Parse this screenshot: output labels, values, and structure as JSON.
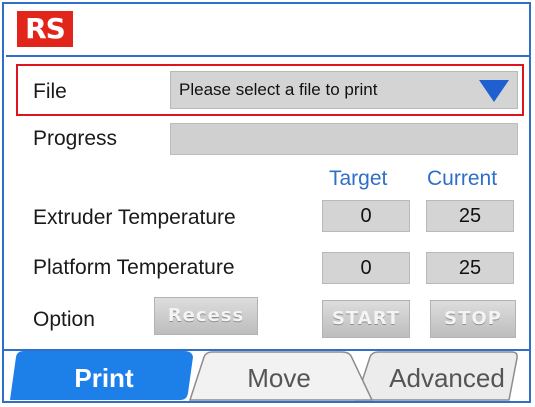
{
  "header": {
    "logo_text": "RS"
  },
  "file": {
    "label": "File",
    "selected": "Please select a file to print"
  },
  "progress": {
    "label": "Progress",
    "value": 0
  },
  "temperatures": {
    "target_header": "Target",
    "current_header": "Current",
    "extruder": {
      "label": "Extruder Temperature",
      "target": "0",
      "current": "25"
    },
    "platform": {
      "label": "Platform Temperature",
      "target": "0",
      "current": "25"
    }
  },
  "option": {
    "label": "Option",
    "recess_label": "Recess",
    "start_label": "START",
    "stop_label": "STOP"
  },
  "tabs": [
    {
      "label": "Print",
      "active": true
    },
    {
      "label": "Move",
      "active": false
    },
    {
      "label": "Advanced",
      "active": false
    }
  ],
  "colors": {
    "accent": "#2f6fc9",
    "highlight_border": "#e0141e",
    "logo": "#e1251b",
    "button_gray": "#c8c8c8"
  }
}
